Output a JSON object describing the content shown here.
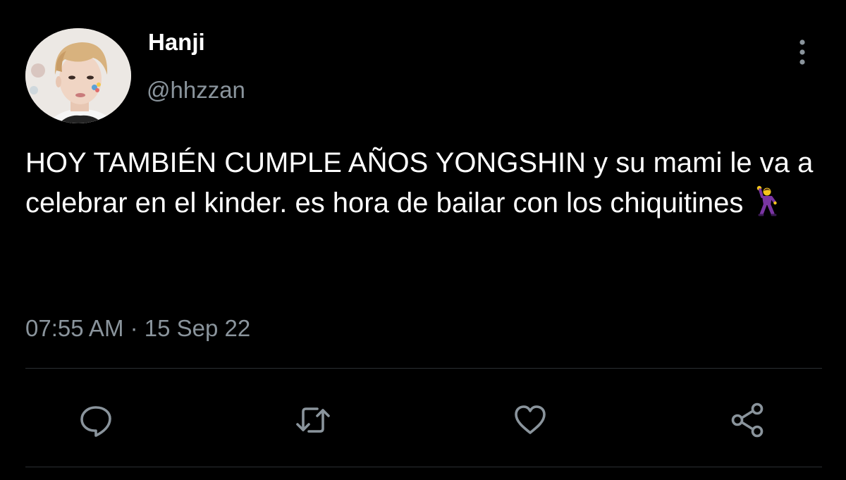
{
  "tweet": {
    "author": {
      "display_name": "Hanji",
      "handle": "@hhzzan",
      "avatar_icon": "profile-photo"
    },
    "text": "HOY TAMBIÉN CUMPLE AÑOS YONGSHIN y su mami le va a celebrar en el kinder. es hora de bailar con los chiquitines",
    "emoji": "man-dancing-emoji",
    "time": "07:55 AM",
    "separator": "·",
    "date": "15 Sep 22"
  },
  "actions": [
    {
      "name": "reply",
      "icon": "comment-icon"
    },
    {
      "name": "retweet",
      "icon": "retweet-icon"
    },
    {
      "name": "like",
      "icon": "heart-icon"
    },
    {
      "name": "share",
      "icon": "share-icon"
    }
  ],
  "colors": {
    "background": "#000000",
    "text_primary": "#ffffff",
    "text_secondary": "#8a949c",
    "icon": "#8a949c",
    "divider": "#2b2f33"
  }
}
